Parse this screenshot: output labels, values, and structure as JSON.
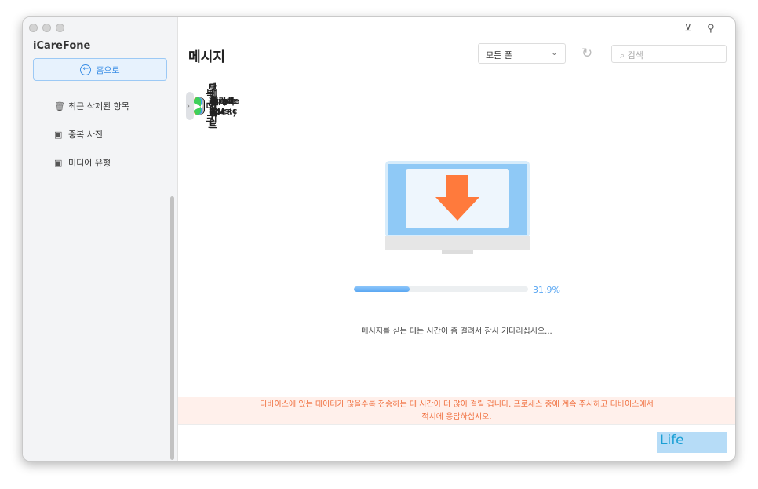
{
  "app_name": "iCareFone",
  "home_button": "홈으로",
  "sidebar": {
    "items": [
      {
        "label": "최근 삭제된 항목",
        "icon": "trash-icon",
        "type": "sub"
      },
      {
        "label": "중복 사진",
        "icon": "photos-icon",
        "type": "sub"
      },
      {
        "label": "미디어 유형",
        "icon": "photos-icon",
        "type": "sub"
      },
      {
        "label": "Apple Music",
        "icon": "music-icon",
        "color": "#fa3e5a",
        "expandable": true
      },
      {
        "label": "Apple TV",
        "icon": "tv-icon",
        "color": "#111111",
        "expandable": true
      },
      {
        "label": "팟캐스트",
        "icon": "podcast-icon",
        "color": "#9b4fd9",
        "expandable": true
      },
      {
        "label": "연락처(418)",
        "icon": "contacts-icon",
        "color": "#b8b8b8",
        "expandable": false
      },
      {
        "label": "메시지",
        "icon": "messages-icon",
        "color": "#3dd05a",
        "expandable": false,
        "active": true
      },
      {
        "label": "앱",
        "icon": "app-store-icon",
        "color": "#1c8ef5",
        "expandable": true
      },
      {
        "label": "도서",
        "icon": "books-icon",
        "color": "#fb8b1e",
        "expandable": true
      },
      {
        "label": "북마크",
        "icon": "bookmark-icon",
        "color": "#fb8b1e",
        "expandable": false
      },
      {
        "label": "파일",
        "icon": "folder-icon",
        "color": "#3ba2f0",
        "expandable": true
      },
      {
        "label": "다운로드",
        "icon": "download-icon",
        "color": "#3dd05a",
        "expandable": false
      }
    ]
  },
  "header": {
    "title": "메시지",
    "device_select": "모든 폰",
    "search_placeholder": "검색"
  },
  "progress": {
    "value": 31.9,
    "label": "31.9%"
  },
  "loading_message": "메시지를 싣는 데는 시간이 좀 걸려서 잠시 기다리십시오...",
  "warning": {
    "line1": "디바이스에 있는 데이터가 많을수록 전송하는 데 시간이 더 많이 걸릴 겁니다. 프로세스 중에 계속 주시하고 디바이스에서",
    "line2": "적시에 응답하십시오."
  },
  "watermark": "Life",
  "colors": {
    "accent": "#3a8ee6",
    "warning": "#f0703f",
    "progress": "#5aa7f2"
  }
}
